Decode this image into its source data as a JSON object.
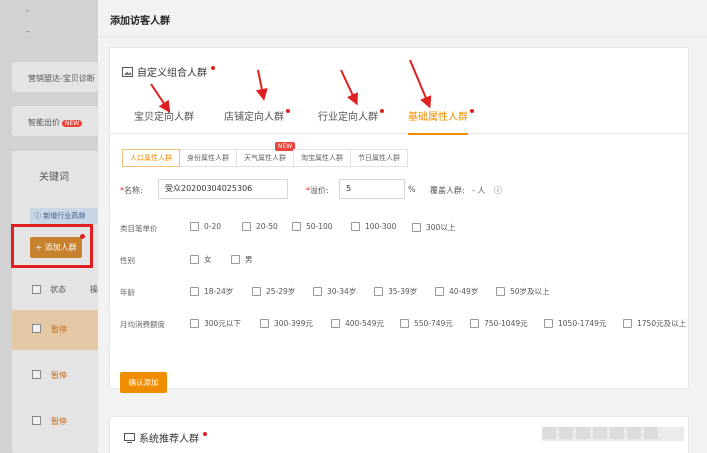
{
  "background": {
    "dashes": [
      "-",
      "-"
    ],
    "promo_text": "营销盟达-宝贝诊断",
    "smart_bid_label": "智能出价",
    "new_badge": "NEW",
    "keyword_label": "关键词",
    "info_text": "新增行业高频",
    "add_crowd_button": "+ 添加人群",
    "status_header": "状态",
    "status_header_2": "操",
    "rows": [
      {
        "status": "暂停"
      },
      {
        "status": "暂停"
      },
      {
        "status": "暂停"
      }
    ]
  },
  "drawer": {
    "title": "添加访客人群",
    "custom_panel": {
      "title": "自定义组合人群",
      "tabs": [
        {
          "label": "宝贝定向人群",
          "active": false,
          "dot": false
        },
        {
          "label": "店铺定向人群",
          "active": false,
          "dot": true
        },
        {
          "label": "行业定向人群",
          "active": false,
          "dot": true
        },
        {
          "label": "基础属性人群",
          "active": true,
          "dot": true
        }
      ],
      "subtabs": [
        {
          "label": "人口属性人群",
          "active": true
        },
        {
          "label": "身份属性人群",
          "active": false
        },
        {
          "label": "天气属性人群",
          "active": false,
          "badge": "NEW"
        },
        {
          "label": "淘宝属性人群",
          "active": false
        },
        {
          "label": "节日属性人群",
          "active": false
        }
      ],
      "name_label": "名称:",
      "name_value": "受众20200304025306",
      "premium_label": "溢价:",
      "premium_value": "5",
      "premium_unit": "%",
      "coverage_label": "覆盖人群:",
      "coverage_value": "- 人",
      "help_icon": "question-circle-icon",
      "groups": [
        {
          "label": "类目笔单价",
          "options": [
            "0-20",
            "20-50",
            "50-100",
            "100-300",
            "300以上"
          ]
        },
        {
          "label": "性别",
          "options": [
            "女",
            "男"
          ]
        },
        {
          "label": "年龄",
          "options": [
            "18-24岁",
            "25-29岁",
            "30-34岁",
            "35-39岁",
            "40-49岁",
            "50岁及以上"
          ]
        },
        {
          "label": "月均消费额度",
          "options": [
            "300元以下",
            "300-399元",
            "400-549元",
            "550-749元",
            "750-1049元",
            "1050-1749元",
            "1750元及以上"
          ]
        }
      ],
      "confirm_button": "确认添加"
    },
    "system_panel": {
      "title": "系统推荐人群",
      "icon": "monitor-icon"
    }
  },
  "colors": {
    "accent": "#f08c00",
    "annotation_red": "#e02020"
  }
}
